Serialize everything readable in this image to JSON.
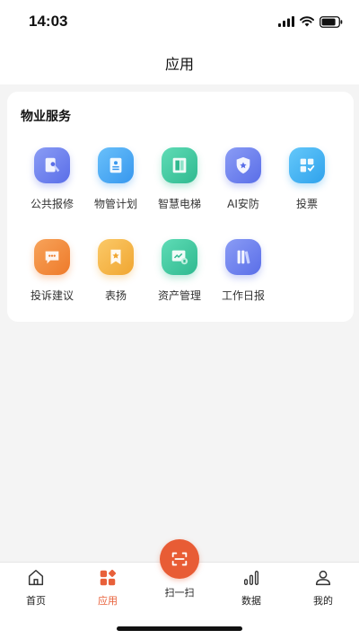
{
  "status": {
    "time": "14:03"
  },
  "header": {
    "title": "应用"
  },
  "card": {
    "title": "物业服务",
    "items": [
      {
        "label": "公共报修",
        "icon": "repair-icon",
        "color": "#6b82f0"
      },
      {
        "label": "物管计划",
        "icon": "plan-icon",
        "color": "#4aa8f5"
      },
      {
        "label": "智慧电梯",
        "icon": "elevator-icon",
        "color": "#3fcba3"
      },
      {
        "label": "AI安防",
        "icon": "security-icon",
        "color": "#6a7ef0"
      },
      {
        "label": "投票",
        "icon": "vote-icon",
        "color": "#3eb5f2"
      },
      {
        "label": "投诉建议",
        "icon": "complaint-icon",
        "color": "#f08a3a"
      },
      {
        "label": "表扬",
        "icon": "praise-icon",
        "color": "#f5b843"
      },
      {
        "label": "资产管理",
        "icon": "asset-icon",
        "color": "#3fcba3"
      },
      {
        "label": "工作日报",
        "icon": "daily-report-icon",
        "color": "#6b82f0"
      }
    ]
  },
  "tabs": [
    {
      "label": "首页",
      "icon": "home-icon",
      "active": false
    },
    {
      "label": "应用",
      "icon": "apps-icon",
      "active": true
    },
    {
      "label": "扫一扫",
      "icon": "scan-icon",
      "active": false
    },
    {
      "label": "数据",
      "icon": "chart-icon",
      "active": false
    },
    {
      "label": "我的",
      "icon": "user-icon",
      "active": false
    }
  ],
  "colors": {
    "accent": "#e85c35",
    "background": "#f4f4f4"
  }
}
